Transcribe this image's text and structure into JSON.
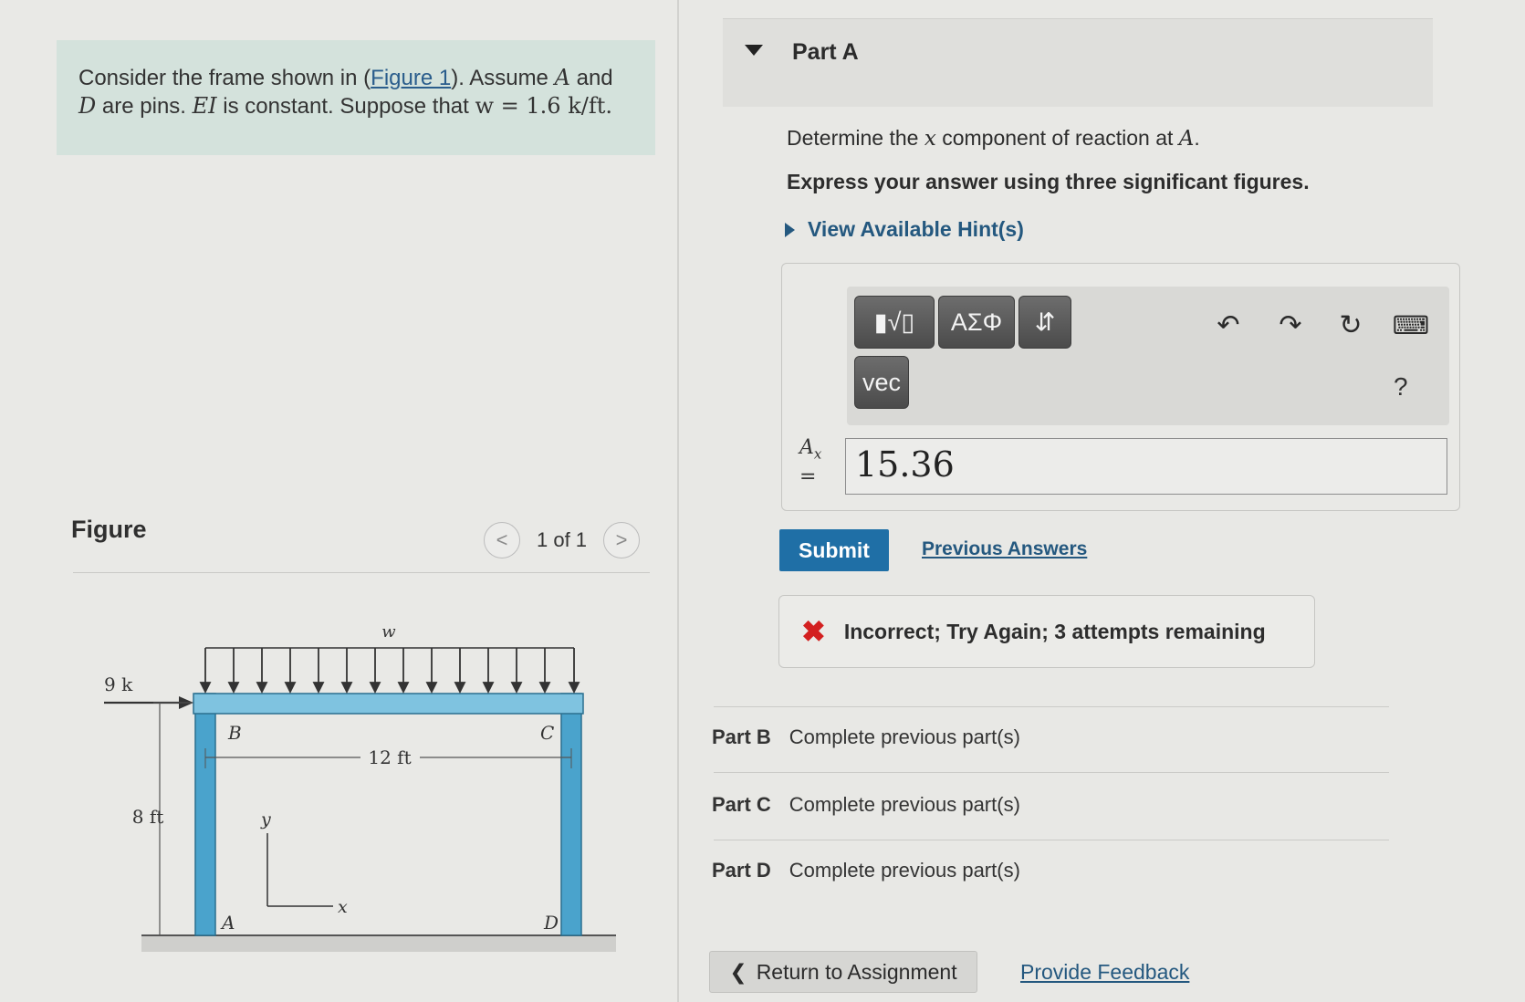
{
  "problem": {
    "text_before_link": "Consider the frame shown in (",
    "figure_link": "Figure 1",
    "text_after_link": "). Assume ",
    "var_a": "A",
    "and": " and",
    "var_d": "D",
    "are_pins": " are pins. ",
    "var_ei": "EI",
    "constant_text": " is constant. Suppose that ",
    "load_expr": "w = 1.6 k/ft."
  },
  "figure": {
    "title": "Figure",
    "counter": "1 of 1",
    "prev": "<",
    "next": ">",
    "labels": {
      "load": "w",
      "force": "9 k",
      "height": "8 ft",
      "span": "12 ft",
      "b": "B",
      "c": "C",
      "a": "A",
      "d": "D",
      "y": "y",
      "x": "x"
    }
  },
  "part_a": {
    "title": "Part A",
    "question_prefix": "Determine the ",
    "question_var": "x",
    "question_mid": " component of reaction at ",
    "question_point": "A",
    "question_end": ".",
    "instruction": "Express your answer using three significant figures.",
    "hints": "View Available Hint(s)"
  },
  "toolbar": {
    "templates_label": "▮√▯",
    "greek_label": "ΑΣΦ",
    "arrows_label": "⇵",
    "vec_label": "vec",
    "undo": "↶",
    "redo": "↷",
    "reset": "↻",
    "keyboard": "⌨",
    "help": "?"
  },
  "answer": {
    "label_var": "A",
    "label_sub": "x",
    "label_eq": "=",
    "value": "15.36"
  },
  "submit_label": "Submit",
  "previous_answers": "Previous Answers",
  "feedback": {
    "icon": "✖",
    "text": "Incorrect; Try Again; 3 attempts remaining"
  },
  "other_parts": [
    {
      "label": "Part B",
      "status": "Complete previous part(s)"
    },
    {
      "label": "Part C",
      "status": "Complete previous part(s)"
    },
    {
      "label": "Part D",
      "status": "Complete previous part(s)"
    }
  ],
  "footer": {
    "return_label": "Return to Assignment",
    "return_icon": "❮",
    "provide_feedback": "Provide Feedback"
  },
  "colors": {
    "accent": "#1f6fa6",
    "link": "#24587f",
    "frame": "#4aa3cc",
    "error": "#d32020",
    "problem_bg": "#d4e2dc"
  }
}
